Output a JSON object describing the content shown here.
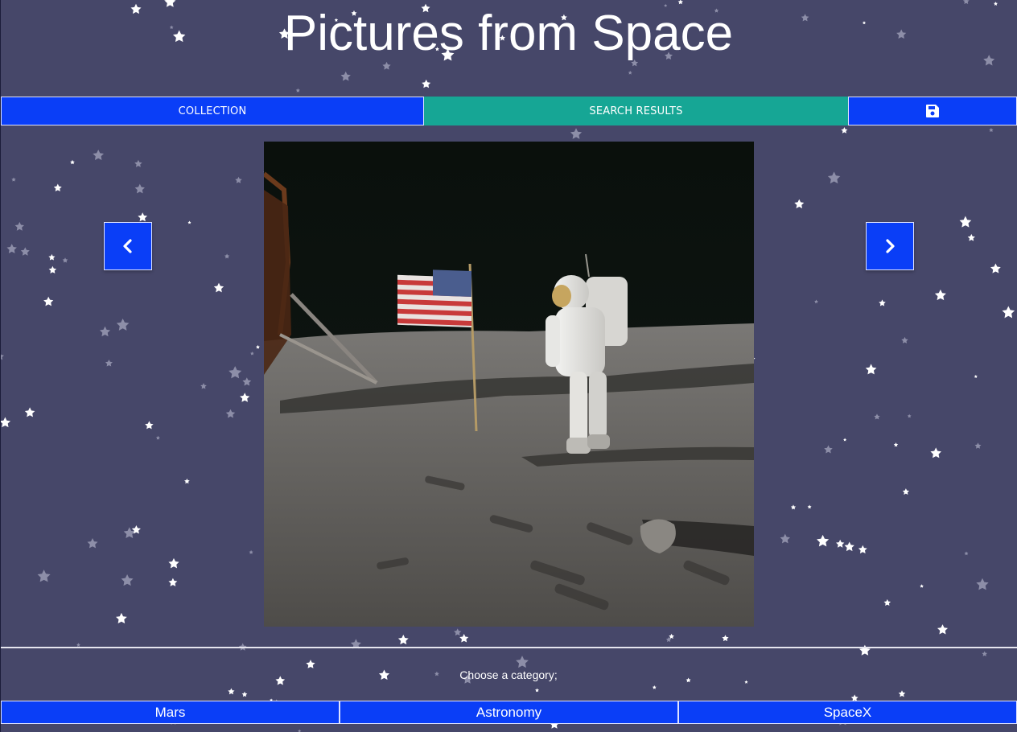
{
  "page": {
    "title": "Pictures from Space",
    "background_color": "#464769"
  },
  "tabs": [
    {
      "label": "COLLECTION",
      "color": "#0a3ef7"
    },
    {
      "label": "SEARCH RESULTS",
      "color": "#16a695",
      "active": true
    },
    {
      "icon": "save-icon",
      "color": "#0a3ef7"
    }
  ],
  "viewer": {
    "prev_icon": "chevron-left-icon",
    "next_icon": "chevron-right-icon"
  },
  "categories": {
    "prompt": "Choose a category;",
    "items": [
      "Mars",
      "Astronomy",
      "SpaceX"
    ]
  }
}
